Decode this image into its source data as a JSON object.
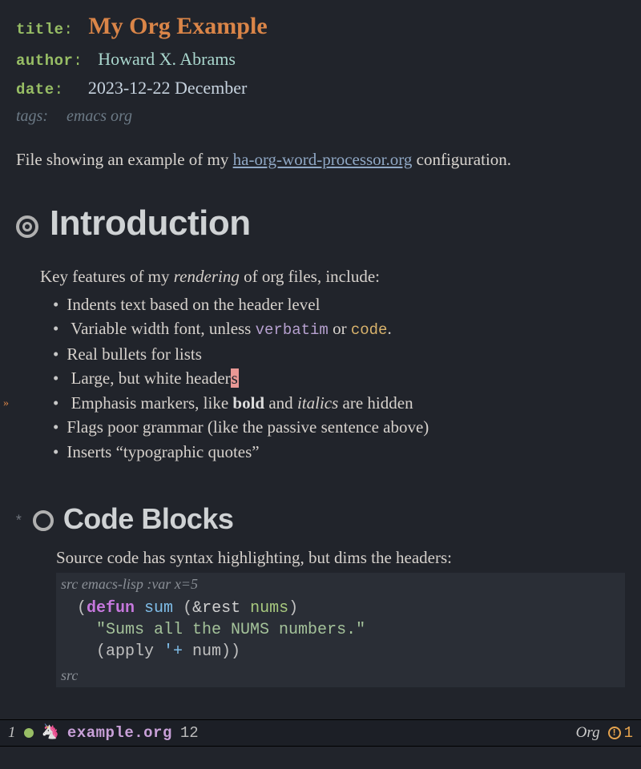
{
  "meta": {
    "title_key": "title",
    "title_val": "My Org Example",
    "author_key": "author",
    "author_val": "Howard X. Abrams",
    "date_key": "date",
    "date_val": "2023-12-22 December",
    "tags_key": "tags:",
    "tags_val": "emacs org"
  },
  "intro": {
    "prefix": "File showing an example of my ",
    "link": "ha-org-word-processor.org",
    "suffix": " configuration."
  },
  "h1": "Introduction",
  "para1_a": "Key features of my ",
  "para1_em": "rendering",
  "para1_b": " of org files, include:",
  "bullets": {
    "b0": "Indents text based on the header level",
    "b1_a": "Variable width font, unless ",
    "b1_verb": "verbatim",
    "b1_b": " or ",
    "b1_code": "code",
    "b1_c": ".",
    "b2": "Real bullets for lists",
    "b3_a": "Large, but white header",
    "b3_cursor": "s",
    "b4_a": "Emphasis markers, like ",
    "b4_bold": "bold",
    "b4_b": " and ",
    "b4_it": "italics",
    "b4_c": " are hidden",
    "b5": "Flags poor grammar (like the passive sentence above)",
    "b6": "Inserts “typographic quotes”"
  },
  "h2": "Code Blocks",
  "code_intro": "Source code has syntax highlighting, but dims the headers:",
  "src": {
    "header_kw": "src",
    "header_lang": " emacs-lisp :var x=5",
    "l1_defun": "defun",
    "l1_name": "sum",
    "l1_amp": "&rest",
    "l1_arg": "nums",
    "l2_doc": "\"Sums all the NUMS numbers.\"",
    "l3_a": "(apply ",
    "l3_q": "'+",
    "l3_b": " num))",
    "footer": "src"
  },
  "modeline": {
    "winnum": "1",
    "unicorn": "🦄",
    "filename": "example.org",
    "col": "12",
    "mode": "Org",
    "warn_count": "1"
  }
}
